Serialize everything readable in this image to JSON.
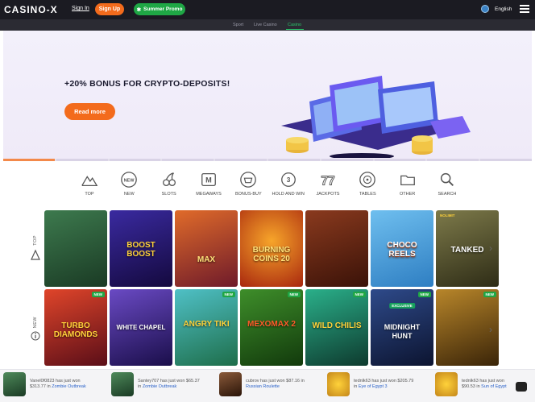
{
  "header": {
    "logo": "CASINO-X",
    "sign_in": "Sign In",
    "sign_up": "Sign Up",
    "promo": "Summer Promo",
    "language": "English"
  },
  "nav": {
    "sport": "Sport",
    "live": "Live Casino",
    "casino": "Casino"
  },
  "banner": {
    "title": "+20% BONUS FOR CRYPTO-DEPOSITS!",
    "button": "Read more",
    "slides_total": 10,
    "slides_active": 1
  },
  "categories": [
    {
      "label": "TOP",
      "icon": "mountain-icon"
    },
    {
      "label": "NEW",
      "icon": "new-badge-icon"
    },
    {
      "label": "SLOTS",
      "icon": "cherries-icon"
    },
    {
      "label": "MEGAWAYS",
      "icon": "megaways-icon"
    },
    {
      "label": "BONUS-BUY",
      "icon": "basket-icon"
    },
    {
      "label": "HOLD AND WIN",
      "icon": "coin-stack-icon"
    },
    {
      "label": "JACKPOTS",
      "icon": "sevens-icon"
    },
    {
      "label": "TABLES",
      "icon": "roulette-icon"
    },
    {
      "label": "OTHER",
      "icon": "folder-icon"
    },
    {
      "label": "SEARCH",
      "icon": "search-icon"
    }
  ],
  "rows": [
    {
      "label": "TOP",
      "games": [
        {
          "name": "",
          "provider": "",
          "badge": "",
          "bg": "#2e5a3a"
        },
        {
          "name": "BOOST BOOST",
          "provider": "",
          "badge": "",
          "bg": "#2b1a6e"
        },
        {
          "name": "MAX",
          "provider": "",
          "badge": "",
          "bg": "#b5452a"
        },
        {
          "name": "BURNING COINS 20",
          "provider": "",
          "badge": "",
          "bg": "#c4471a"
        },
        {
          "name": "",
          "provider": "",
          "badge": "",
          "bg": "#6e2a1c"
        },
        {
          "name": "CHOCO REELS",
          "provider": "",
          "badge": "",
          "bg": "#4d9fd6"
        },
        {
          "name": "TANKED",
          "provider": "NOLIMIT",
          "badge": "",
          "bg": "#5b5a34"
        }
      ]
    },
    {
      "label": "NEW",
      "games": [
        {
          "name": "TURBO DIAMONDS",
          "provider": "",
          "badge": "NEW",
          "bg": "#8a1f2a"
        },
        {
          "name": "WHITE CHAPEL",
          "provider": "",
          "badge": "",
          "bg": "#4b2f8a"
        },
        {
          "name": "ANGRY TIKI",
          "provider": "",
          "badge": "NEW",
          "bg": "#2b8d8c"
        },
        {
          "name": "MEXOMAX 2",
          "provider": "",
          "badge": "NEW",
          "bg": "#2a6b1c"
        },
        {
          "name": "WILD CHILIS",
          "provider": "",
          "badge": "NEW",
          "bg": "#1e7d5a"
        },
        {
          "name": "MIDNIGHT HUNT",
          "provider": "",
          "badge": "NEW",
          "excl": "EXCLUSIVE",
          "bg": "#1c2e55"
        },
        {
          "name": "",
          "provider": "",
          "badge": "NEW",
          "bg": "#6e4a1c"
        }
      ]
    }
  ],
  "ticker": [
    {
      "text": "Vanel0f0823 has just won $313.77 in",
      "game": "Zombie Outbreak",
      "color": "#3a6a4a"
    },
    {
      "text": "Santey707 has just won $65.37 in",
      "game": "Zombie Outbreak",
      "color": "#3a6a4a"
    },
    {
      "text": "cubrov has just won $87.16 in",
      "game": "Russian Roulette",
      "color": "#5a3a2a"
    },
    {
      "text": "tednlk63 has just won $205.79 in",
      "game": "Eye of Egypt 3",
      "color": "#c49a2a"
    },
    {
      "text": "tednlk63 has just won $90.53 in",
      "game": "Sun of Egypt",
      "color": "#c49a2a"
    }
  ]
}
